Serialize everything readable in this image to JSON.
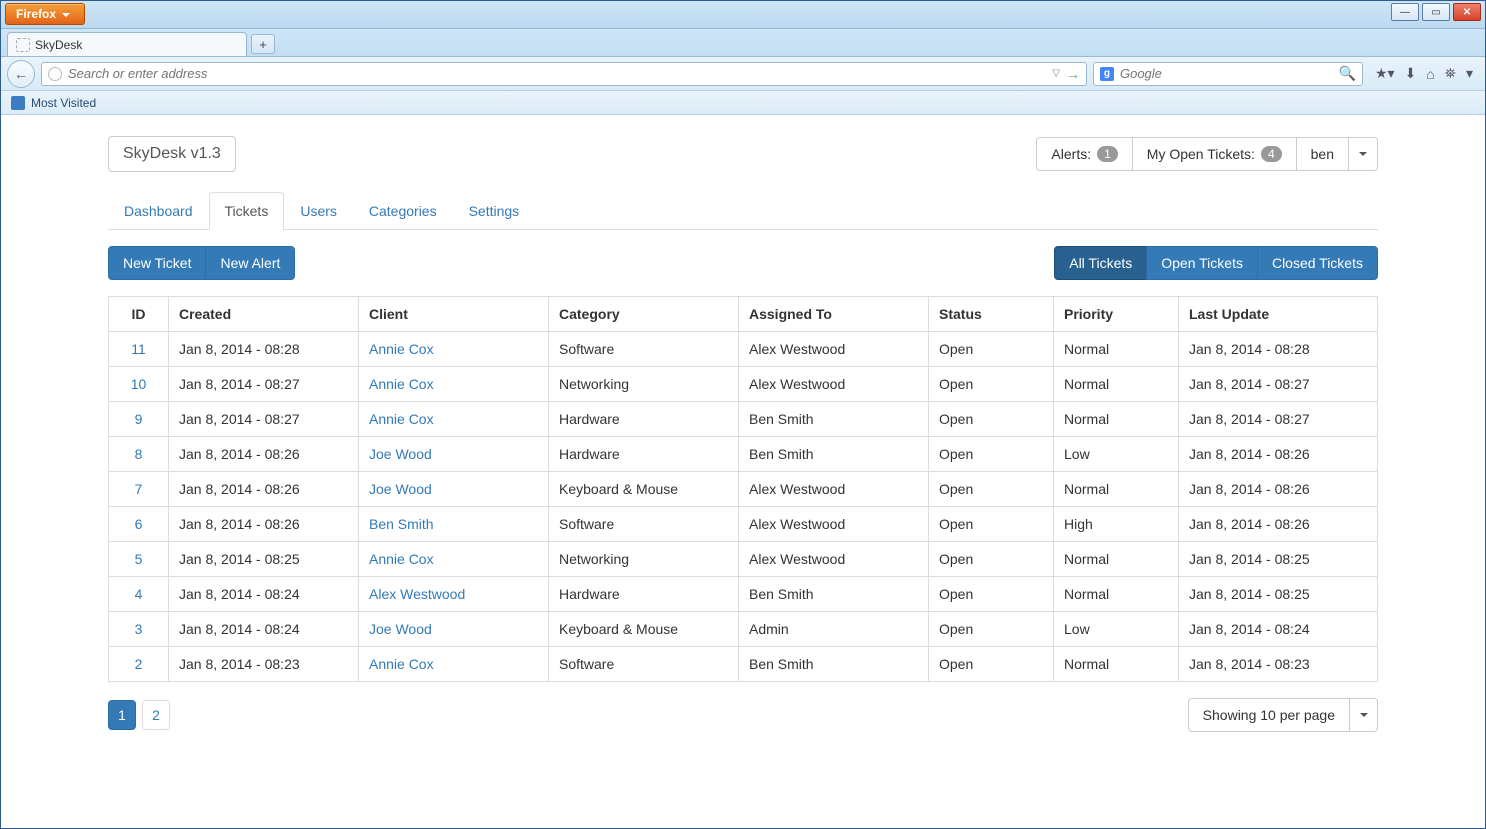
{
  "browser": {
    "app_button": "Firefox",
    "tab_title": "SkyDesk",
    "url_placeholder": "Search or enter address",
    "search_placeholder": "Google",
    "bookmark_mostvisited": "Most Visited"
  },
  "header": {
    "brand": "SkyDesk v1.3",
    "alerts_label": "Alerts:",
    "alerts_count": "1",
    "myopen_label": "My Open Tickets:",
    "myopen_count": "4",
    "user": "ben"
  },
  "tabs": {
    "dashboard": "Dashboard",
    "tickets": "Tickets",
    "users": "Users",
    "categories": "Categories",
    "settings": "Settings"
  },
  "actions": {
    "new_ticket": "New Ticket",
    "new_alert": "New Alert"
  },
  "filters": {
    "all": "All Tickets",
    "open": "Open Tickets",
    "closed": "Closed Tickets"
  },
  "table": {
    "headers": {
      "id": "ID",
      "created": "Created",
      "client": "Client",
      "category": "Category",
      "assigned": "Assigned To",
      "status": "Status",
      "priority": "Priority",
      "last_update": "Last Update"
    },
    "rows": [
      {
        "id": "11",
        "created": "Jan 8, 2014 - 08:28",
        "client": "Annie Cox",
        "category": "Software",
        "assigned": "Alex Westwood",
        "status": "Open",
        "priority": "Normal",
        "last_update": "Jan 8, 2014 - 08:28"
      },
      {
        "id": "10",
        "created": "Jan 8, 2014 - 08:27",
        "client": "Annie Cox",
        "category": "Networking",
        "assigned": "Alex Westwood",
        "status": "Open",
        "priority": "Normal",
        "last_update": "Jan 8, 2014 - 08:27"
      },
      {
        "id": "9",
        "created": "Jan 8, 2014 - 08:27",
        "client": "Annie Cox",
        "category": "Hardware",
        "assigned": "Ben Smith",
        "status": "Open",
        "priority": "Normal",
        "last_update": "Jan 8, 2014 - 08:27"
      },
      {
        "id": "8",
        "created": "Jan 8, 2014 - 08:26",
        "client": "Joe Wood",
        "category": "Hardware",
        "assigned": "Ben Smith",
        "status": "Open",
        "priority": "Low",
        "last_update": "Jan 8, 2014 - 08:26"
      },
      {
        "id": "7",
        "created": "Jan 8, 2014 - 08:26",
        "client": "Joe Wood",
        "category": "Keyboard & Mouse",
        "assigned": "Alex Westwood",
        "status": "Open",
        "priority": "Normal",
        "last_update": "Jan 8, 2014 - 08:26"
      },
      {
        "id": "6",
        "created": "Jan 8, 2014 - 08:26",
        "client": "Ben Smith",
        "category": "Software",
        "assigned": "Alex Westwood",
        "status": "Open",
        "priority": "High",
        "last_update": "Jan 8, 2014 - 08:26"
      },
      {
        "id": "5",
        "created": "Jan 8, 2014 - 08:25",
        "client": "Annie Cox",
        "category": "Networking",
        "assigned": "Alex Westwood",
        "status": "Open",
        "priority": "Normal",
        "last_update": "Jan 8, 2014 - 08:25"
      },
      {
        "id": "4",
        "created": "Jan 8, 2014 - 08:24",
        "client": "Alex Westwood",
        "category": "Hardware",
        "assigned": "Ben Smith",
        "status": "Open",
        "priority": "Normal",
        "last_update": "Jan 8, 2014 - 08:25"
      },
      {
        "id": "3",
        "created": "Jan 8, 2014 - 08:24",
        "client": "Joe Wood",
        "category": "Keyboard & Mouse",
        "assigned": "Admin",
        "status": "Open",
        "priority": "Low",
        "last_update": "Jan 8, 2014 - 08:24"
      },
      {
        "id": "2",
        "created": "Jan 8, 2014 - 08:23",
        "client": "Annie Cox",
        "category": "Software",
        "assigned": "Ben Smith",
        "status": "Open",
        "priority": "Normal",
        "last_update": "Jan 8, 2014 - 08:23"
      }
    ]
  },
  "pagination": {
    "page1": "1",
    "page2": "2",
    "per_page_label": "Showing 10 per page"
  }
}
